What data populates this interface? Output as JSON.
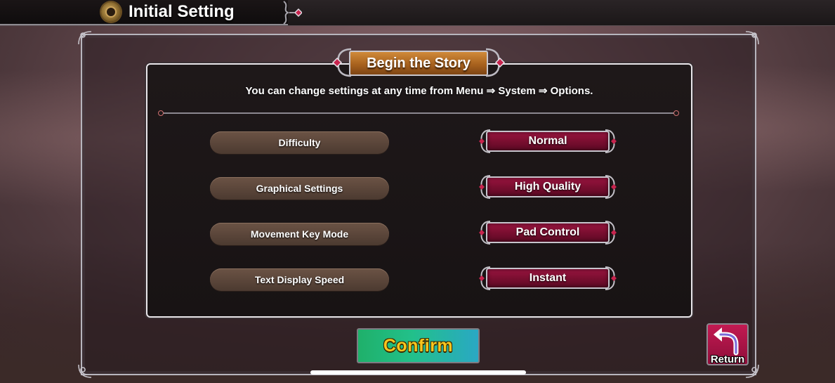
{
  "header": {
    "title": "Initial Setting",
    "emblem_icon": "clock-gear-emblem-icon"
  },
  "panel": {
    "title": "Begin the Story",
    "subtitle": "You can change settings at any time from Menu ⇒ System ⇒ Options."
  },
  "settings": [
    {
      "label": "Difficulty",
      "value": "Normal"
    },
    {
      "label": "Graphical Settings",
      "value": "High Quality"
    },
    {
      "label": "Movement Key Mode",
      "value": "Pad Control"
    },
    {
      "label": "Text Display Speed",
      "value": "Instant"
    }
  ],
  "buttons": {
    "confirm_label": "Confirm",
    "return_label": "Return",
    "return_icon": "return-arrow-icon"
  },
  "colors": {
    "value_button": "#8f1138",
    "label_pill": "#5a4538",
    "confirm_start": "#1fb06a",
    "confirm_end": "#2aa8c4",
    "confirm_text": "#f7c51e",
    "title_plate": "#b8702a",
    "return_button": "#b01848"
  }
}
